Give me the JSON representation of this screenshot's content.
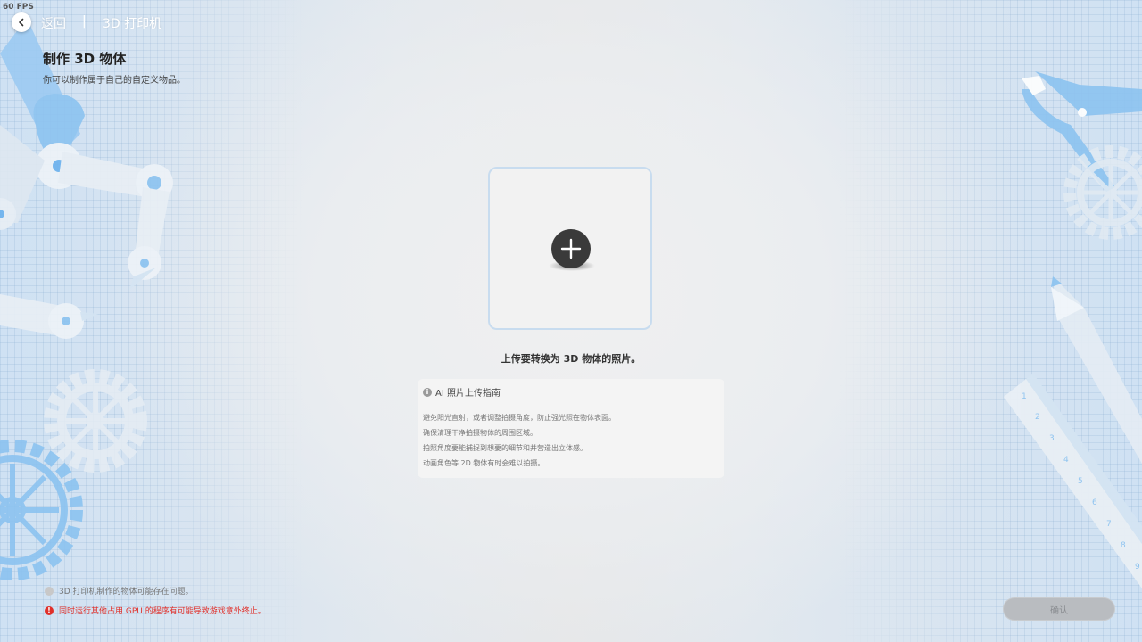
{
  "overlay": {
    "fps": "60 FPS"
  },
  "header": {
    "back_label": "返回",
    "separator": "|",
    "breadcrumb": "3D 打印机"
  },
  "page": {
    "title": "制作 3D 物体",
    "subtitle": "你可以制作属于自己的自定义物品。"
  },
  "upload": {
    "caption": "上传要转换为 3D 物体的照片。"
  },
  "guide": {
    "title": "AI 照片上传指南",
    "items": [
      "避免阳光直射，或者调整拍摄角度，防止强光照在物体表面。",
      "确保清理干净拍摄物体的周围区域。",
      "拍照角度要能捕捉到想要的细节和并营造出立体感。",
      "动画角色等 2D 物体有时会难以拍摄。"
    ]
  },
  "footer": {
    "notice": "3D 打印机制作的物体可能存在问题。",
    "warning": "同时运行其他占用 GPU 的程序有可能导致游戏意外终止。",
    "confirm_label": "确认"
  },
  "colors": {
    "accent_blue": "#8cc3f0",
    "warning_red": "#e0302a",
    "button_disabled": "#b9bcc0"
  },
  "icons": [
    "chevron-left-icon",
    "plus-icon",
    "info-icon",
    "alert-icon",
    "robot-arm-illustration",
    "gear-illustration",
    "pliers-illustration",
    "ruler-illustration",
    "pencil-illustration"
  ]
}
